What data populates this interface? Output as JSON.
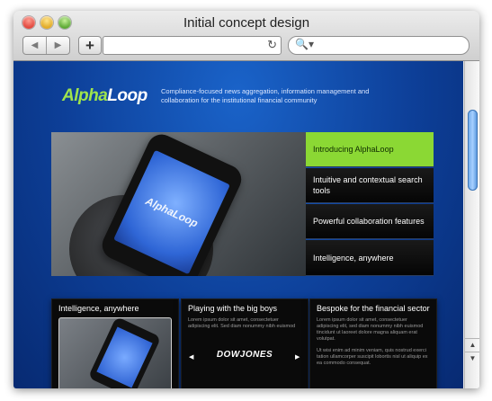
{
  "window": {
    "title": "Initial concept design"
  },
  "toolbar": {
    "back_glyph": "◀",
    "forward_glyph": "▶",
    "new_tab_glyph": "+",
    "reload_glyph": "↻",
    "search_glyph": "🔍▾",
    "url_value": "",
    "search_value": ""
  },
  "site": {
    "logo_part1": "Alpha",
    "logo_part2": "Loop",
    "tagline": "Compliance-focused news aggregation, information management and collaboration for the institutional financial community",
    "hero_phone_text": "AlphaLoop",
    "menu": [
      "Introducing AlphaLoop",
      "Intuitive and contextual search tools",
      "Powerful collaboration features",
      "Intelligence, anywhere"
    ],
    "cards": [
      {
        "title": "Intelligence, anywhere"
      },
      {
        "title": "Playing with the big boys",
        "text": "Lorem ipsum dolor sit amet, consectetuer adipiscing elit. Sed diam nonummy nibh euismod",
        "logo": "DOWJONES",
        "prev": "◀",
        "next": "▶"
      },
      {
        "title": "Bespoke for the financial sector",
        "text": "Lorem ipsum dolor sit amet, consectetuer adipiscing elit, sed diam nonummy nibh euismod tincidunt ut laoreet dolore magna aliquam erat volutpat.",
        "text2": "Ut wisi enim ad minim veniam, quis nostrud exerci tation ullamcorper suscipit lobortis nisl ut aliquip ex ea commodo consequat."
      }
    ]
  },
  "scrollbar": {
    "up": "▲",
    "down": "▼"
  }
}
